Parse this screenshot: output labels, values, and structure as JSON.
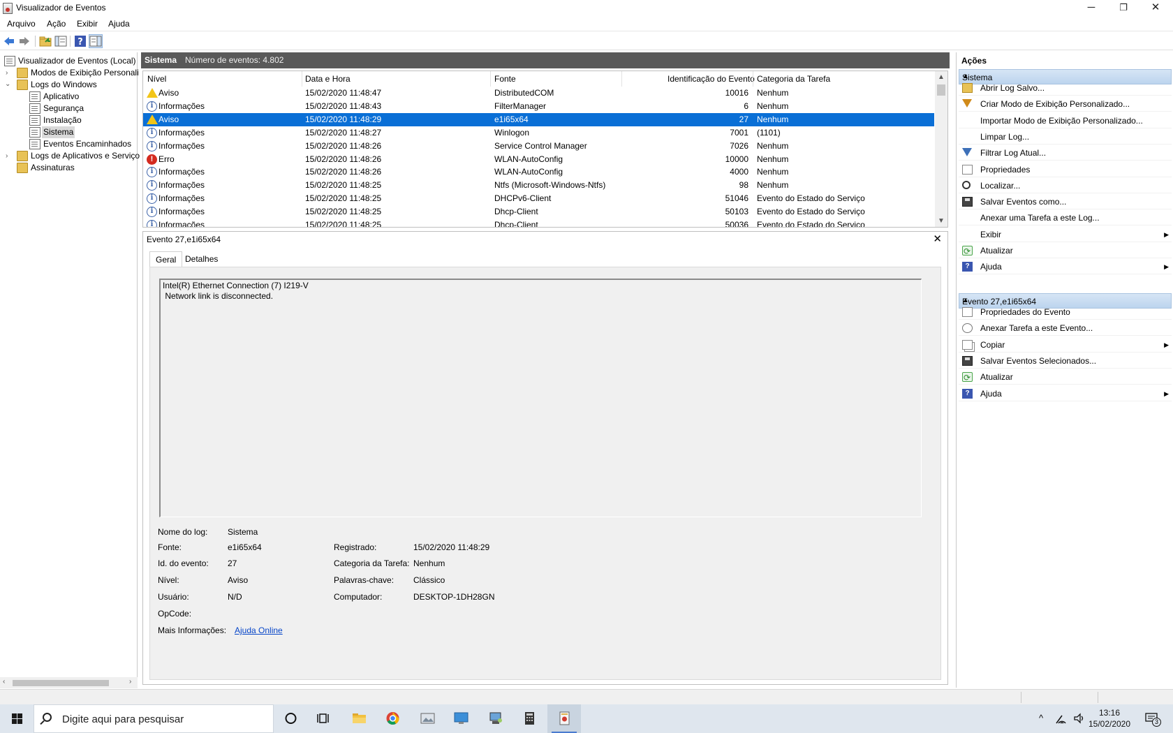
{
  "window": {
    "title": "Visualizador de Eventos",
    "minimize": "─",
    "restore": "❐",
    "close": "✕"
  },
  "menu": [
    "Arquivo",
    "Ação",
    "Exibir",
    "Ajuda"
  ],
  "tree": {
    "root": "Visualizador de Eventos (Local)",
    "custom_views": "Modos de Exibição Personali",
    "windows_logs": "Logs do Windows",
    "application": "Aplicativo",
    "security": "Segurança",
    "setup": "Instalação",
    "system": "Sistema",
    "forwarded": "Eventos Encaminhados",
    "app_services": "Logs de Aplicativos e Serviço",
    "subscriptions": "Assinaturas"
  },
  "center": {
    "log_name": "Sistema",
    "event_count": "Número de eventos: 4.802",
    "columns": {
      "level": "Nível",
      "datetime": "Data e Hora",
      "source": "Fonte",
      "event_id": "Identificação do Evento",
      "category": "Categoria da Tarefa"
    },
    "rows": [
      {
        "type": "warn",
        "level": "Aviso",
        "datetime": "15/02/2020 11:48:47",
        "source": "DistributedCOM",
        "id": "10016",
        "category": "Nenhum"
      },
      {
        "type": "info",
        "level": "Informações",
        "datetime": "15/02/2020 11:48:43",
        "source": "FilterManager",
        "id": "6",
        "category": "Nenhum"
      },
      {
        "type": "warn",
        "level": "Aviso",
        "datetime": "15/02/2020 11:48:29",
        "source": "e1i65x64",
        "id": "27",
        "category": "Nenhum"
      },
      {
        "type": "info",
        "level": "Informações",
        "datetime": "15/02/2020 11:48:27",
        "source": "Winlogon",
        "id": "7001",
        "category": "(1101)"
      },
      {
        "type": "info",
        "level": "Informações",
        "datetime": "15/02/2020 11:48:26",
        "source": "Service Control Manager",
        "id": "7026",
        "category": "Nenhum"
      },
      {
        "type": "err",
        "level": "Erro",
        "datetime": "15/02/2020 11:48:26",
        "source": "WLAN-AutoConfig",
        "id": "10000",
        "category": "Nenhum"
      },
      {
        "type": "info",
        "level": "Informações",
        "datetime": "15/02/2020 11:48:26",
        "source": "WLAN-AutoConfig",
        "id": "4000",
        "category": "Nenhum"
      },
      {
        "type": "info",
        "level": "Informações",
        "datetime": "15/02/2020 11:48:25",
        "source": "Ntfs (Microsoft-Windows-Ntfs)",
        "id": "98",
        "category": "Nenhum"
      },
      {
        "type": "info",
        "level": "Informações",
        "datetime": "15/02/2020 11:48:25",
        "source": "DHCPv6-Client",
        "id": "51046",
        "category": "Evento do Estado do Serviço"
      },
      {
        "type": "info",
        "level": "Informações",
        "datetime": "15/02/2020 11:48:25",
        "source": "Dhcp-Client",
        "id": "50103",
        "category": "Evento do Estado do Serviço"
      },
      {
        "type": "info",
        "level": "Informações",
        "datetime": "15/02/2020 11:48:25",
        "source": "Dhcp-Client",
        "id": "50036",
        "category": "Evento do Estado do Serviço"
      }
    ],
    "selected_row": 2
  },
  "detail": {
    "title": "Evento 27,e1i65x64",
    "close": "✕",
    "tab_general": "Geral",
    "tab_details": "Detalhes",
    "message_line1": "Intel(R) Ethernet Connection (7) I219-V",
    "message_line2": " Network link is disconnected.",
    "labels": {
      "log_name": "Nome do log:",
      "source": "Fonte:",
      "event_id": "Id. do evento:",
      "level": "Nível:",
      "user": "Usuário:",
      "opcode": "OpCode:",
      "more_info": "Mais Informações:",
      "logged": "Registrado:",
      "task_category": "Categoria da Tarefa:",
      "keywords": "Palavras-chave:",
      "computer": "Computador:"
    },
    "values": {
      "log_name": "Sistema",
      "source": "e1i65x64",
      "event_id": "27",
      "level": "Aviso",
      "user": "N/D",
      "opcode": "",
      "more_info": "Ajuda Online",
      "logged": "15/02/2020 11:48:29",
      "task_category": "Nenhum",
      "keywords": "Clássico",
      "computer": "DESKTOP-1DH28GN"
    }
  },
  "actions": {
    "title": "Ações",
    "group1": "Sistema",
    "group1_items": [
      {
        "label": "Abrir Log Salvo...",
        "icon": "open-folder-icon"
      },
      {
        "label": "Criar Modo de Exibição Personalizado...",
        "icon": "filter-icon"
      },
      {
        "label": "Importar Modo de Exibição Personalizado...",
        "icon": ""
      },
      {
        "label": "Limpar Log...",
        "icon": ""
      },
      {
        "label": "Filtrar Log Atual...",
        "icon": "filter-icon"
      },
      {
        "label": "Propriedades",
        "icon": "properties-icon"
      },
      {
        "label": "Localizar...",
        "icon": "binoculars-icon"
      },
      {
        "label": "Salvar Eventos como...",
        "icon": "save-icon"
      },
      {
        "label": "Anexar uma Tarefa a este Log...",
        "icon": ""
      },
      {
        "label": "Exibir",
        "icon": "",
        "submenu": "▶"
      },
      {
        "label": "Atualizar",
        "icon": "refresh-icon"
      },
      {
        "label": "Ajuda",
        "icon": "help-icon",
        "submenu": "▶"
      }
    ],
    "group2": "Evento 27,e1i65x64",
    "group2_items": [
      {
        "label": "Propriedades do Evento",
        "icon": "properties-icon"
      },
      {
        "label": "Anexar Tarefa a este Evento...",
        "icon": "task-icon"
      },
      {
        "label": "Copiar",
        "icon": "copy-icon",
        "submenu": "▶"
      },
      {
        "label": "Salvar Eventos Selecionados...",
        "icon": "save-icon"
      },
      {
        "label": "Atualizar",
        "icon": "refresh-icon"
      },
      {
        "label": "Ajuda",
        "icon": "help-icon",
        "submenu": "▶"
      }
    ],
    "collapse": "▲"
  },
  "taskbar": {
    "search_placeholder": "Digite aqui para pesquisar",
    "time": "13:16",
    "date": "15/02/2020",
    "notifications": "3"
  },
  "colors": {
    "selection": "#0a6fd6",
    "header_dark": "#595959",
    "action_group": "#bcd4ee"
  }
}
